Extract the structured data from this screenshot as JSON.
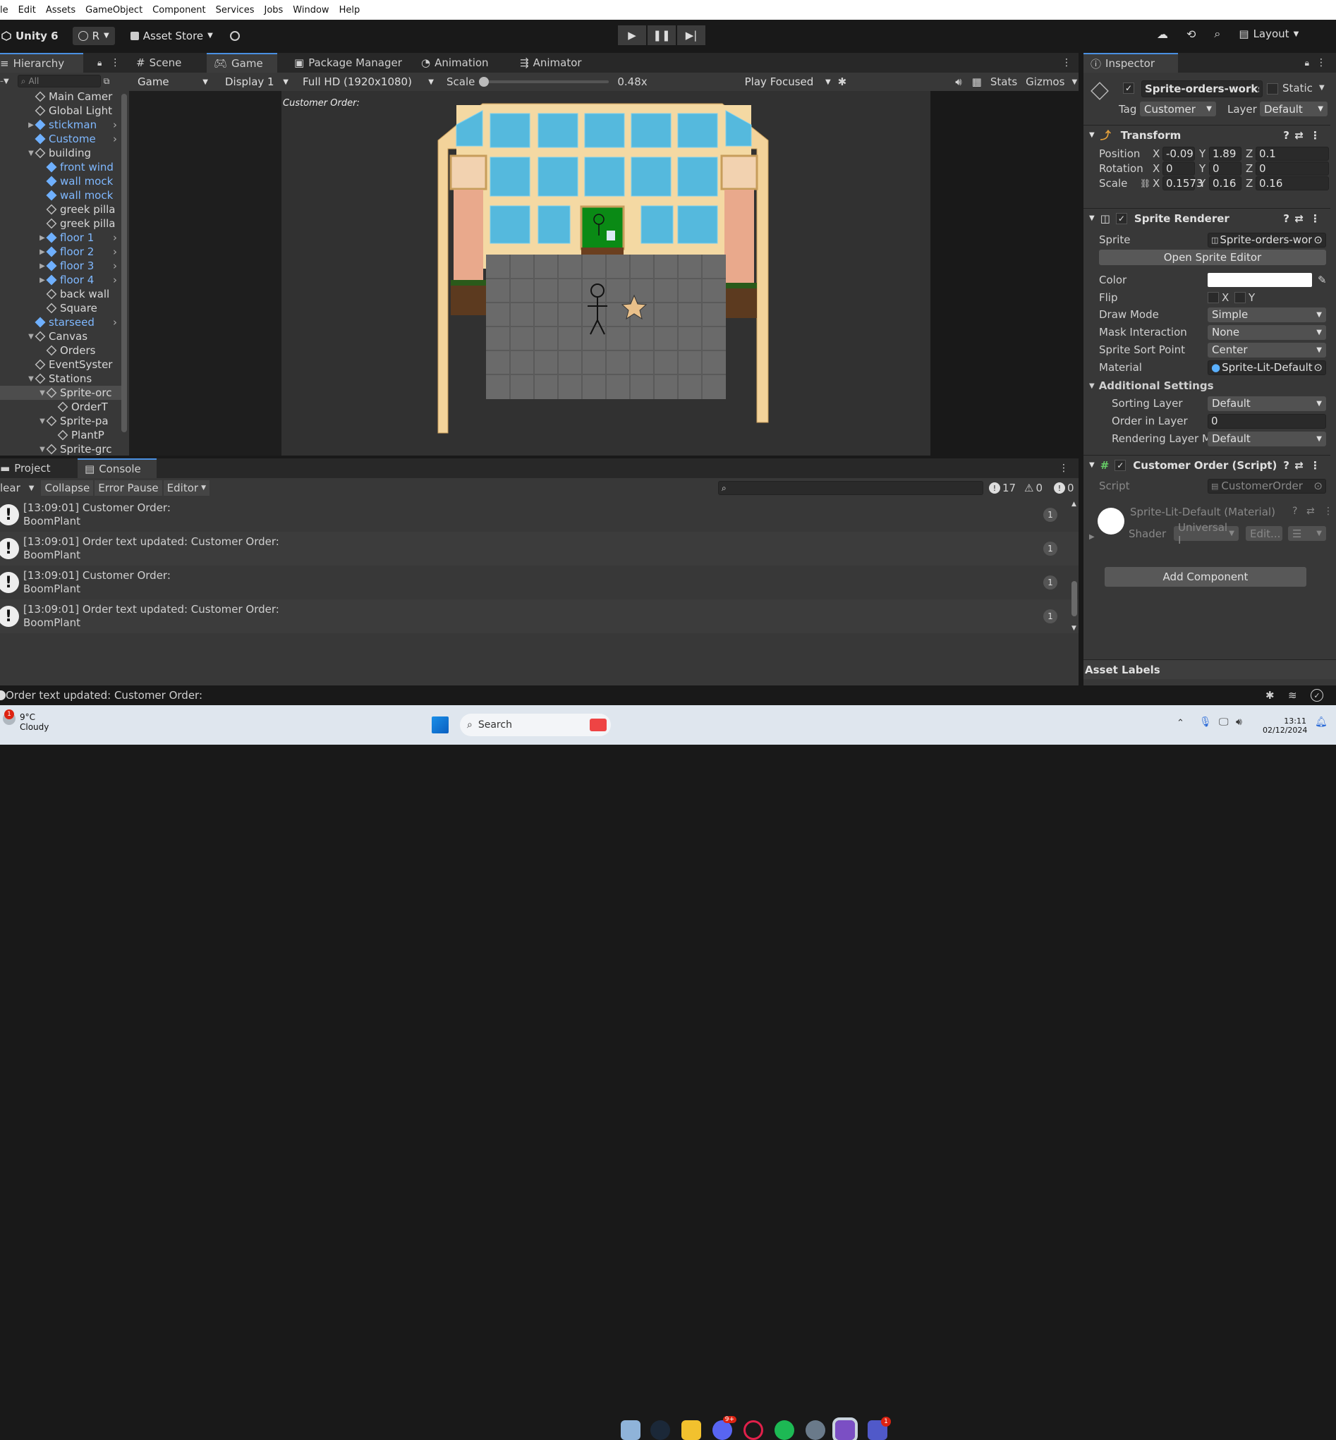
{
  "menu": [
    "le",
    "Edit",
    "Assets",
    "GameObject",
    "Component",
    "Services",
    "Jobs",
    "Window",
    "Help"
  ],
  "toolbar": {
    "unity_label": "Unity 6",
    "account_label": "R",
    "asset_store_label": "Asset Store",
    "layout_label": "Layout"
  },
  "tabs_left": {
    "hierarchy": "Hierarchy",
    "scene": "Scene",
    "game": "Game",
    "package_manager": "Package Manager",
    "animation": "Animation",
    "animator": "Animator",
    "inspector": "Inspector"
  },
  "hierarchy": {
    "search_placeholder": "All",
    "items": [
      {
        "label": "Main Camer",
        "indent": 0,
        "prefab": false,
        "arrow": "",
        "sel": false
      },
      {
        "label": "Global Light",
        "indent": 0,
        "prefab": false,
        "arrow": "",
        "sel": false
      },
      {
        "label": "stickman",
        "indent": 0,
        "prefab": true,
        "arrow": "▶",
        "sel": false
      },
      {
        "label": "Custome",
        "indent": 0,
        "prefab": true,
        "arrow": "",
        "sel": false
      },
      {
        "label": "building",
        "indent": 0,
        "prefab": false,
        "arrow": "▼",
        "sel": false
      },
      {
        "label": "front wind",
        "indent": 1,
        "prefab": true,
        "arrow": "",
        "sel": false
      },
      {
        "label": "wall mock",
        "indent": 1,
        "prefab": true,
        "arrow": "",
        "sel": false
      },
      {
        "label": "wall mock",
        "indent": 1,
        "prefab": true,
        "arrow": "",
        "sel": false
      },
      {
        "label": "greek pilla",
        "indent": 1,
        "prefab": false,
        "arrow": "",
        "sel": false
      },
      {
        "label": "greek pilla",
        "indent": 1,
        "prefab": false,
        "arrow": "",
        "sel": false
      },
      {
        "label": "floor 1",
        "indent": 1,
        "prefab": true,
        "arrow": "▶",
        "sel": false
      },
      {
        "label": "floor 2",
        "indent": 1,
        "prefab": true,
        "arrow": "▶",
        "sel": false
      },
      {
        "label": "floor 3",
        "indent": 1,
        "prefab": true,
        "arrow": "▶",
        "sel": false
      },
      {
        "label": "floor 4",
        "indent": 1,
        "prefab": true,
        "arrow": "▶",
        "sel": false
      },
      {
        "label": "back wall",
        "indent": 1,
        "prefab": false,
        "arrow": "",
        "sel": false
      },
      {
        "label": "Square",
        "indent": 1,
        "prefab": false,
        "arrow": "",
        "sel": false
      },
      {
        "label": "starseed",
        "indent": 0,
        "prefab": true,
        "arrow": "",
        "sel": false
      },
      {
        "label": "Canvas",
        "indent": 0,
        "prefab": false,
        "arrow": "▼",
        "sel": false
      },
      {
        "label": "Orders",
        "indent": 1,
        "prefab": false,
        "arrow": "",
        "sel": false
      },
      {
        "label": "EventSyster",
        "indent": 0,
        "prefab": false,
        "arrow": "",
        "sel": false
      },
      {
        "label": "Stations",
        "indent": 0,
        "prefab": false,
        "arrow": "▼",
        "sel": false
      },
      {
        "label": "Sprite-orc",
        "indent": 1,
        "prefab": false,
        "arrow": "▼",
        "sel": true
      },
      {
        "label": "OrderT",
        "indent": 2,
        "prefab": false,
        "arrow": "",
        "sel": false
      },
      {
        "label": "Sprite-pa",
        "indent": 1,
        "prefab": false,
        "arrow": "▼",
        "sel": false
      },
      {
        "label": "PlantP",
        "indent": 2,
        "prefab": false,
        "arrow": "",
        "sel": false
      },
      {
        "label": "Sprite-grc",
        "indent": 1,
        "prefab": false,
        "arrow": "▼",
        "sel": false
      }
    ]
  },
  "gamebar": {
    "display_mode": "Game",
    "display": "Display 1",
    "resolution": "Full HD (1920x1080)",
    "scale_label": "Scale",
    "scale_value": "0.48x",
    "play_focused": "Play Focused",
    "stats": "Stats",
    "gizmos": "Gizmos"
  },
  "game": {
    "customer_order": "Customer Order:"
  },
  "inspector": {
    "object_name": "Sprite-orders-workst",
    "static_label": "Static",
    "tag_label": "Tag",
    "tag_value": "Customer",
    "layer_label": "Layer",
    "layer_value": "Default",
    "transform": {
      "title": "Transform",
      "position": {
        "label": "Position",
        "x": "-0.09",
        "y": "1.89",
        "z": "0.1"
      },
      "rotation": {
        "label": "Rotation",
        "x": "0",
        "y": "0",
        "z": "0"
      },
      "scale": {
        "label": "Scale",
        "x": "0.1573",
        "y": "0.16",
        "z": "0.16"
      }
    },
    "sprite_renderer": {
      "title": "Sprite Renderer",
      "sprite_label": "Sprite",
      "sprite_value": "Sprite-orders-wor",
      "open_editor": "Open Sprite Editor",
      "color_label": "Color",
      "flip_label": "Flip",
      "flip_x": "X",
      "flip_y": "Y",
      "draw_mode_label": "Draw Mode",
      "draw_mode": "Simple",
      "mask_label": "Mask Interaction",
      "mask": "None",
      "sort_point_label": "Sprite Sort Point",
      "sort_point": "Center",
      "material_label": "Material",
      "material": "Sprite-Lit-Default",
      "additional": "Additional Settings",
      "sorting_layer_label": "Sorting Layer",
      "sorting_layer": "Default",
      "order_label": "Order in Layer",
      "order": "0",
      "rendering_label": "Rendering Layer M",
      "rendering": "Default"
    },
    "customer_order": {
      "title": "Customer Order (Script)",
      "script_label": "Script",
      "script_value": "CustomerOrder"
    },
    "material": {
      "title": "Sprite-Lit-Default (Material)",
      "shader_label": "Shader",
      "shader_value": "Universal I",
      "edit": "Edit..."
    },
    "add_component": "Add Component",
    "asset_labels": "Asset Labels"
  },
  "console": {
    "tab_project": "Project",
    "tab_console": "Console",
    "clear": "lear",
    "collapse": "Collapse",
    "error_pause": "Error Pause",
    "editor": "Editor",
    "count_info": "17",
    "count_warn": "0",
    "count_err": "0",
    "rows": [
      {
        "line1": "[13:09:01] Customer Order:",
        "line2": "BoomPlant",
        "count": "1"
      },
      {
        "line1": "[13:09:01] Order text updated: Customer Order:",
        "line2": "BoomPlant",
        "count": "1"
      },
      {
        "line1": "[13:09:01] Customer Order:",
        "line2": "BoomPlant",
        "count": "1"
      },
      {
        "line1": "[13:09:01] Order text updated: Customer Order:",
        "line2": "BoomPlant",
        "count": "1"
      }
    ],
    "status": "Order text updated: Customer Order:"
  },
  "taskbar": {
    "weather_temp": "9°C",
    "weather_desc": "Cloudy",
    "weather_badge": "1",
    "search": "Search",
    "time": "13:11",
    "date": "02/12/2024",
    "discord_badge": "9+",
    "teams_badge": "1"
  }
}
